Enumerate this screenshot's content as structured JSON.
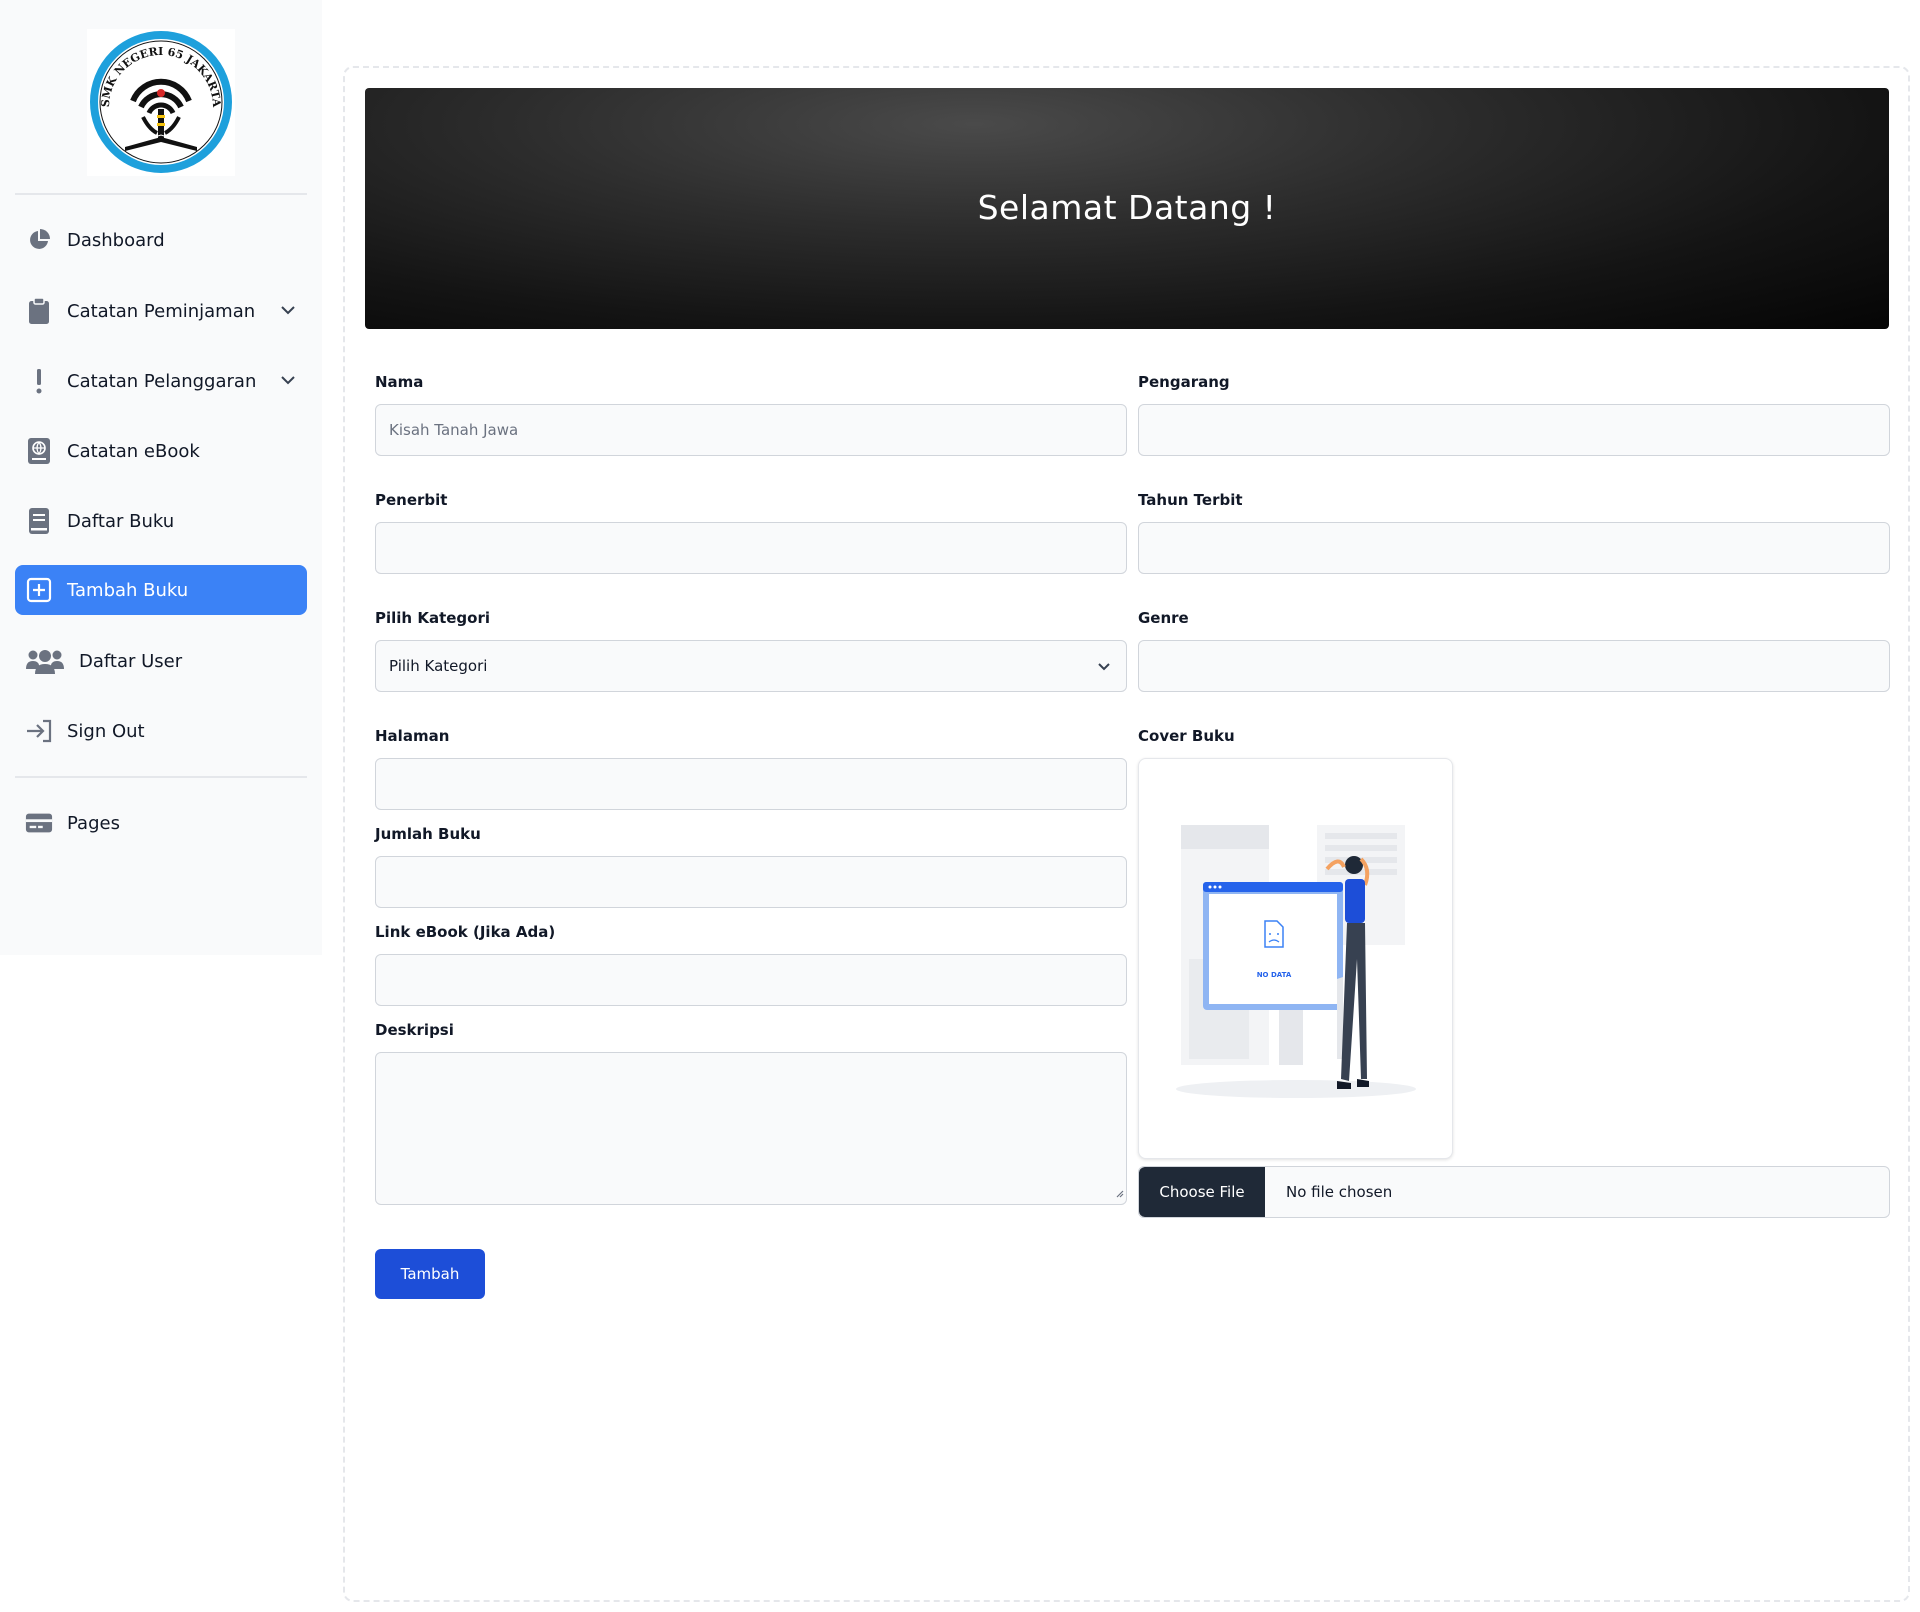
{
  "sidebar": {
    "logo_text": "SMK NEGERI 65 JAKARTA",
    "items": [
      {
        "label": "Dashboard",
        "icon": "pie-chart-icon"
      },
      {
        "label": "Catatan Peminjaman",
        "icon": "clipboard-icon",
        "expandable": true
      },
      {
        "label": "Catatan Pelanggaran",
        "icon": "exclamation-icon",
        "expandable": true
      },
      {
        "label": "Catatan eBook",
        "icon": "globe-book-icon"
      },
      {
        "label": "Daftar Buku",
        "icon": "book-icon"
      },
      {
        "label": "Tambah Buku",
        "icon": "plus-square-icon",
        "active": true
      },
      {
        "label": "Daftar User",
        "icon": "users-icon"
      },
      {
        "label": "Sign Out",
        "icon": "sign-out-icon"
      }
    ],
    "secondary_items": [
      {
        "label": "Pages",
        "icon": "card-icon"
      }
    ]
  },
  "banner": {
    "title": "Selamat Datang !"
  },
  "form": {
    "nama": {
      "label": "Nama",
      "value": "",
      "placeholder": "Kisah Tanah Jawa"
    },
    "pengarang": {
      "label": "Pengarang",
      "value": "",
      "placeholder": ""
    },
    "penerbit": {
      "label": "Penerbit",
      "value": "",
      "placeholder": ""
    },
    "tahun_terbit": {
      "label": "Tahun Terbit",
      "value": "",
      "placeholder": ""
    },
    "kategori": {
      "label": "Pilih Kategori",
      "selected": "Pilih Kategori"
    },
    "genre": {
      "label": "Genre",
      "value": "",
      "placeholder": ""
    },
    "halaman": {
      "label": "Halaman",
      "value": "",
      "placeholder": ""
    },
    "jumlah_buku": {
      "label": "Jumlah Buku",
      "value": "",
      "placeholder": ""
    },
    "link_ebook": {
      "label": "Link eBook (Jika Ada)",
      "value": "",
      "placeholder": ""
    },
    "deskripsi": {
      "label": "Deskripsi",
      "value": ""
    },
    "cover": {
      "label": "Cover Buku",
      "preview_text": "NO DATA",
      "button": "Choose File",
      "status": "No file chosen"
    },
    "submit_label": "Tambah"
  },
  "colors": {
    "accent": "#3b82f6",
    "submit": "#1d4ed8",
    "file_button": "#1f2937",
    "sidebar_bg": "#f9fafb"
  }
}
